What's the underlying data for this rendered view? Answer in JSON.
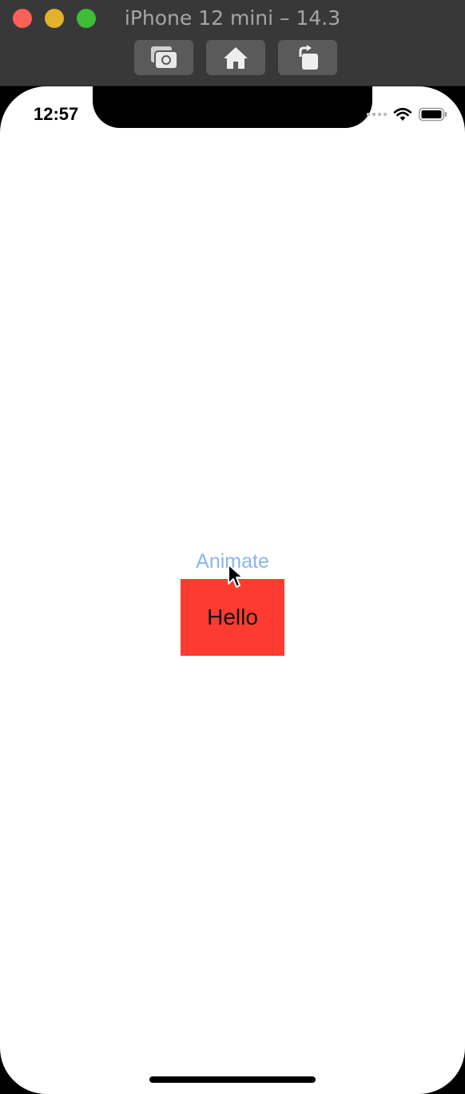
{
  "window": {
    "title": "iPhone 12 mini – 14.3",
    "toolbar": {
      "screenshot_icon": "camera-icon",
      "home_icon": "home-icon",
      "rotate_icon": "rotate-icon"
    }
  },
  "status_bar": {
    "time": "12:57",
    "icons": [
      "signal-icon",
      "wifi-icon",
      "battery-icon"
    ]
  },
  "content": {
    "animate_button": "Animate",
    "hello_label": "Hello",
    "box_color": "#fe3b30",
    "button_color": "#8bb6ea"
  }
}
